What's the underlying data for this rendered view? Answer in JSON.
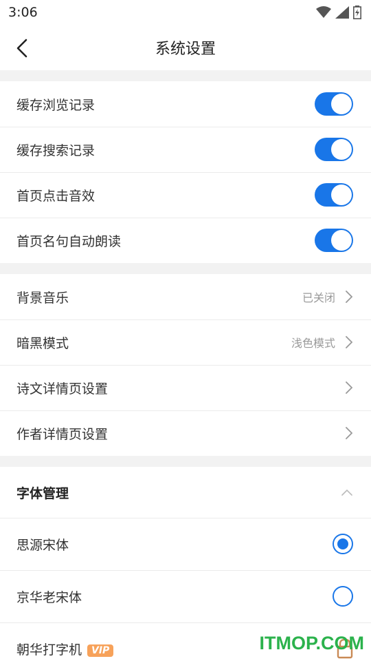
{
  "status_bar": {
    "time": "3:06"
  },
  "nav": {
    "title": "系统设置"
  },
  "toggles": [
    {
      "label": "缓存浏览记录",
      "on": true
    },
    {
      "label": "缓存搜索记录",
      "on": true
    },
    {
      "label": "首页点击音效",
      "on": true
    },
    {
      "label": "首页名句自动朗读",
      "on": true
    }
  ],
  "settings": [
    {
      "label": "背景音乐",
      "value": "已关闭"
    },
    {
      "label": "暗黑模式",
      "value": "浅色模式"
    },
    {
      "label": "诗文详情页设置",
      "value": ""
    },
    {
      "label": "作者详情页设置",
      "value": ""
    }
  ],
  "fonts": {
    "title": "字体管理",
    "items": [
      {
        "label": "思源宋体",
        "selected": true
      },
      {
        "label": "京华老宋体",
        "selected": false
      },
      {
        "label": "朝华打字机",
        "vip": "VIP"
      }
    ]
  },
  "watermark": "ITMOP.COM",
  "colors": {
    "accent": "#1976e8",
    "vip": "#f7a25a",
    "watermark": "#2bb24c"
  }
}
